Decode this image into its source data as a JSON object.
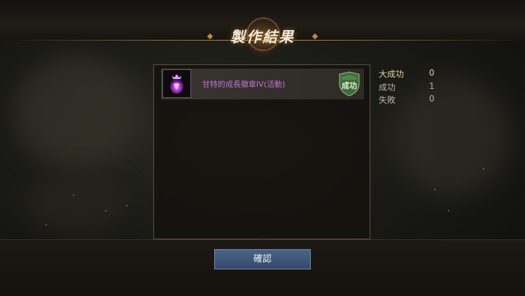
{
  "header": {
    "title": "製作結果"
  },
  "results": [
    {
      "item_name": "甘特的成長徽章IV(活動)",
      "item_icon": "purple-lion-crest-icon",
      "status": "成功"
    }
  ],
  "stats": [
    {
      "label": "大成功",
      "value": "0"
    },
    {
      "label": "成功",
      "value": "1"
    },
    {
      "label": "失敗",
      "value": "0"
    }
  ],
  "confirm_label": "確認",
  "colors": {
    "accent": "#c99a45",
    "item_purple": "#c074d8",
    "button_blue": "#3e5577",
    "success_green": "#3f6a3a"
  }
}
